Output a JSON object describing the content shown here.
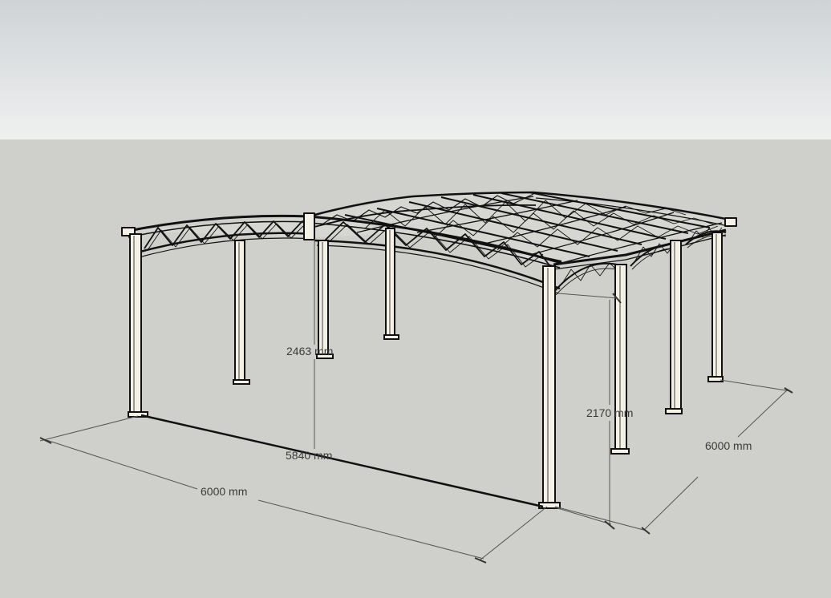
{
  "colors": {
    "sky_top": "#cfd3d6",
    "sky_bottom": "#eff0f0",
    "ground": "#cfd0cc",
    "structure_fill": "#f4f1e6",
    "structure_line": "#111111",
    "dimension_line": "#555555"
  },
  "dimensions": {
    "front_width": "6000 mm",
    "side_depth": "6000 mm",
    "ridge_height": "2463 mm",
    "span_length": "5840 mm",
    "eave_height": "2170 mm"
  }
}
